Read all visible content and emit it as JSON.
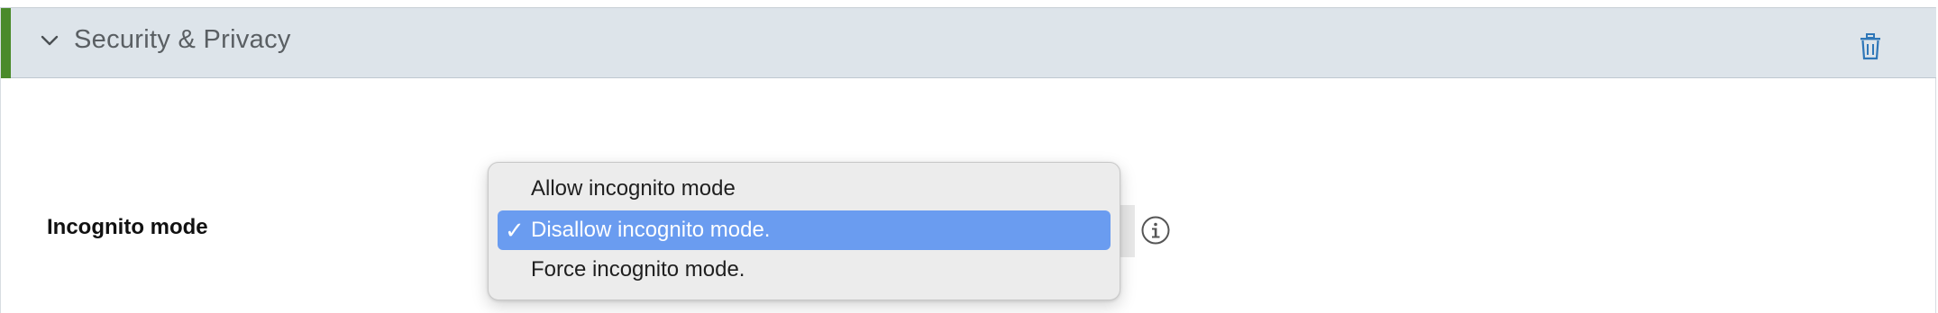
{
  "section": {
    "title": "Security & Privacy",
    "accent_color": "#4a8a2a",
    "icons": {
      "collapse": "chevron-down-icon",
      "delete": "trash-icon"
    }
  },
  "field": {
    "label": "Incognito mode",
    "info_icon": "info-icon"
  },
  "dropdown": {
    "options": [
      {
        "label": "Allow incognito mode",
        "selected": false
      },
      {
        "label": "Disallow incognito mode.",
        "selected": true
      },
      {
        "label": "Force incognito mode.",
        "selected": false
      }
    ],
    "check_mark": "✓",
    "highlight_color": "#6a9cf0"
  }
}
